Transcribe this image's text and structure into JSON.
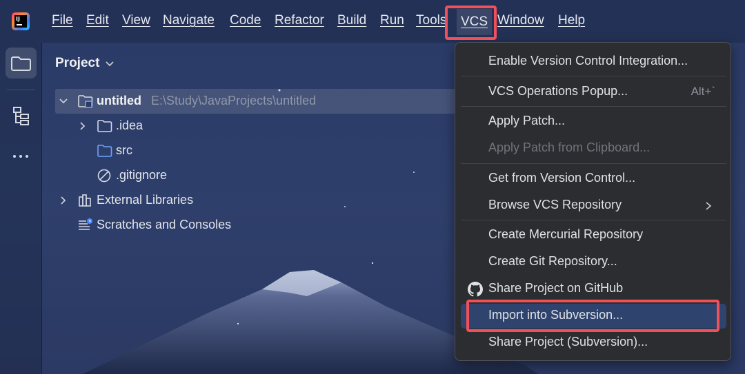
{
  "menubar": {
    "items": [
      {
        "label": "File"
      },
      {
        "label": "Edit"
      },
      {
        "label": "View"
      },
      {
        "label": "Navigate"
      },
      {
        "label": "Code"
      },
      {
        "label": "Refactor"
      },
      {
        "label": "Build"
      },
      {
        "label": "Run"
      },
      {
        "label": "Tools"
      },
      {
        "label": "VCS"
      },
      {
        "label": "Window"
      },
      {
        "label": "Help"
      }
    ],
    "active": "VCS"
  },
  "toolstrip": {
    "icons": [
      "folder-icon",
      "structure-icon",
      "more-icon"
    ]
  },
  "project_panel": {
    "title": "Project",
    "tree": [
      {
        "name": "untitled",
        "path": "E:\\Study\\JavaProjects\\untitled",
        "icon": "module-folder-icon",
        "expanded": true
      },
      {
        "name": ".idea",
        "icon": "folder-icon",
        "expanded": false
      },
      {
        "name": "src",
        "icon": "source-folder-icon"
      },
      {
        "name": ".gitignore",
        "icon": "ignore-file-icon"
      },
      {
        "name": "External Libraries",
        "icon": "library-icon",
        "expanded": false
      },
      {
        "name": "Scratches and Consoles",
        "icon": "scratches-icon"
      }
    ]
  },
  "vcs_menu": {
    "items": [
      {
        "label": "Enable Version Control Integration..."
      },
      {
        "label": "VCS Operations Popup...",
        "shortcut": "Alt+`"
      },
      {
        "label": "Apply Patch..."
      },
      {
        "label": "Apply Patch from Clipboard...",
        "disabled": true
      },
      {
        "label": "Get from Version Control..."
      },
      {
        "label": "Browse VCS Repository",
        "submenu": true
      },
      {
        "label": "Create Mercurial Repository"
      },
      {
        "label": "Create Git Repository..."
      },
      {
        "label": "Share Project on GitHub",
        "icon": "github-icon"
      },
      {
        "label": "Import into Subversion...",
        "highlighted": true
      },
      {
        "label": "Share Project (Subversion)..."
      }
    ]
  },
  "colors": {
    "highlight_box": "#f0505a",
    "menu_hover": "#2e436e",
    "menu_bg": "#2b2d30"
  }
}
